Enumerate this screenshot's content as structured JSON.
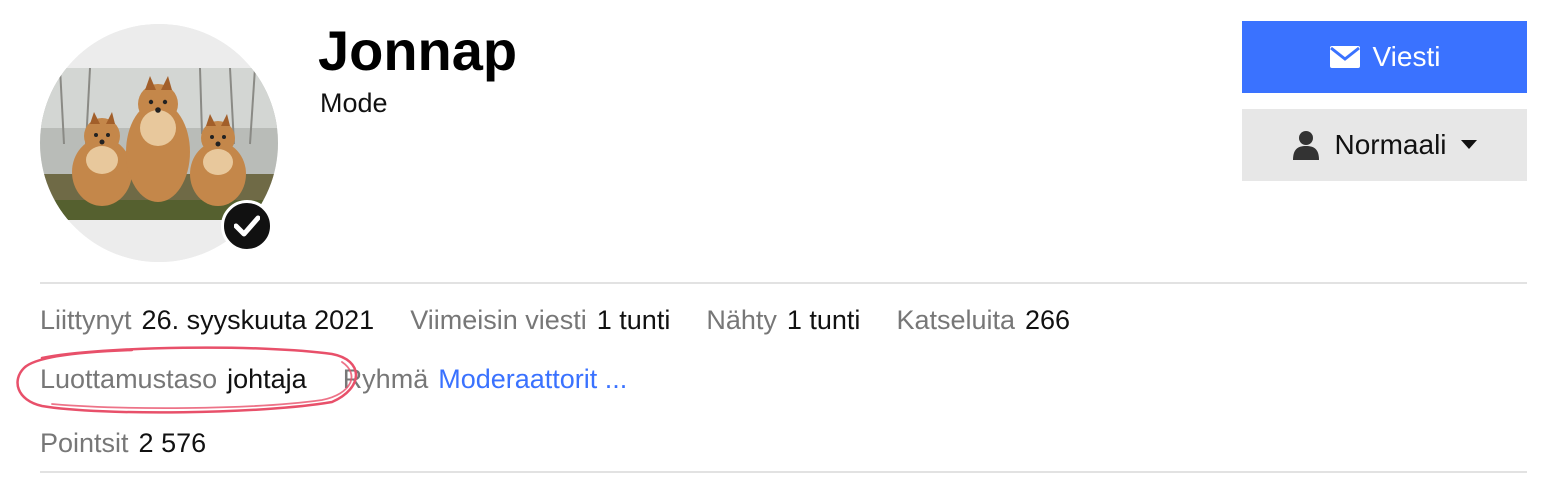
{
  "profile": {
    "username": "Jonnap",
    "title": "Mode",
    "avatar_alt": "Three Pomeranian dogs"
  },
  "actions": {
    "message_label": "Viesti",
    "follow_label": "Normaali",
    "message_icon": "envelope-icon",
    "follow_icon": "user-icon"
  },
  "stats": {
    "joined_label": "Liittynyt",
    "joined_value": "26. syyskuuta 2021",
    "last_post_label": "Viimeisin viesti",
    "last_post_value": "1 tunti",
    "seen_label": "Nähty",
    "seen_value": "1 tunti",
    "views_label": "Katseluita",
    "views_value": "266",
    "trust_label": "Luottamustaso",
    "trust_value": "johtaja",
    "group_label": "Ryhmä",
    "group_value": "Moderaattorit ...",
    "points_label": "Pointsit",
    "points_value": "2 576"
  },
  "colors": {
    "accent": "#3a72ff",
    "secondary_bg": "#e7e7e7",
    "annotation": "#e8506a"
  }
}
